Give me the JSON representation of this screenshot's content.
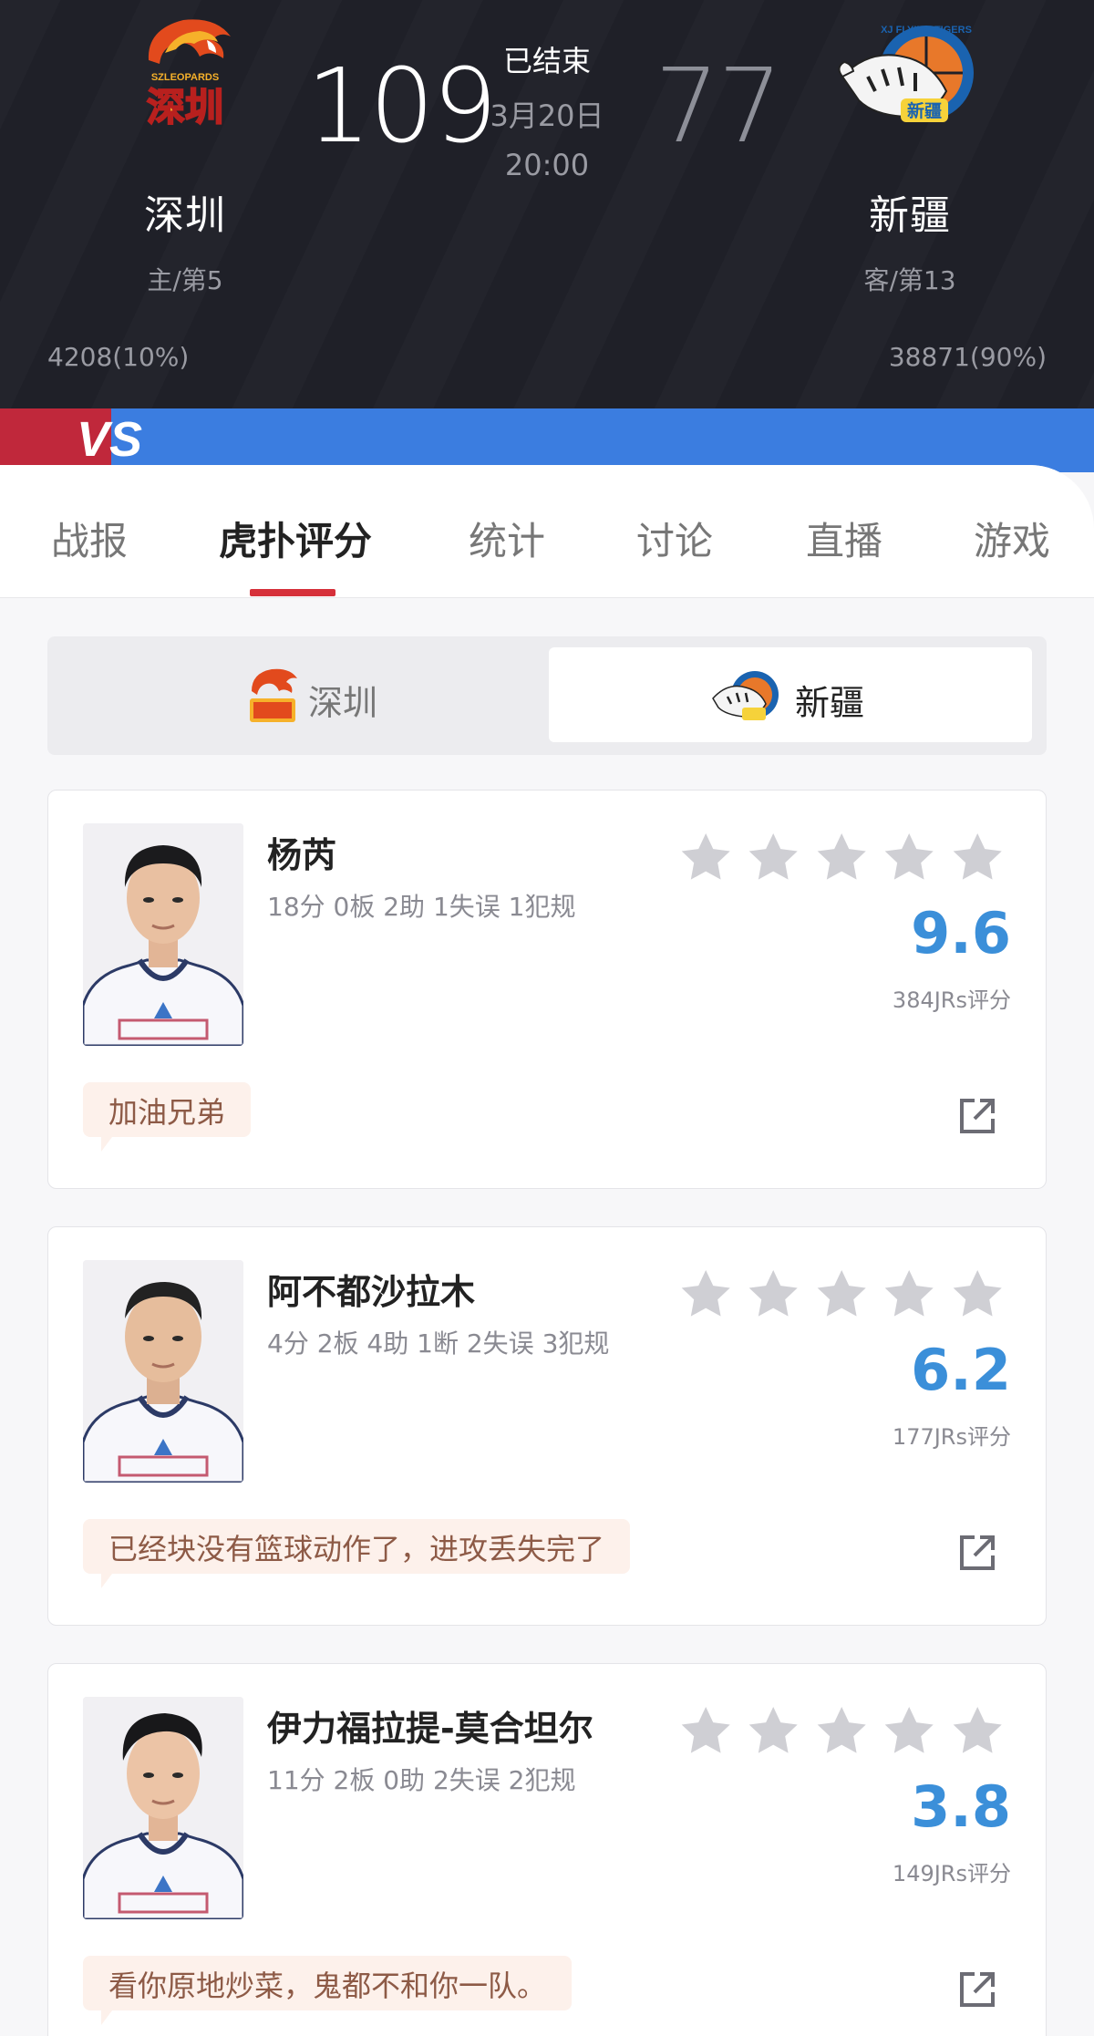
{
  "header": {
    "status": "已结束",
    "date": "3月20日",
    "time": "20:00",
    "home": {
      "name": "深圳",
      "rank": "主/第5",
      "score": "109",
      "support": "4208(10%)",
      "logo_text_top": "SZLEOPARDS",
      "logo_text_main": "深圳"
    },
    "away": {
      "name": "新疆",
      "rank": "客/第13",
      "score": "77",
      "support": "38871(90%)",
      "logo_text_ring": "XJ FLYING TIGERS",
      "logo_text_main": "新疆"
    },
    "vs_label": "VS",
    "support_fraction": {
      "home": 0.1,
      "away": 0.9
    }
  },
  "tabs": [
    {
      "label": "战报"
    },
    {
      "label": "虎扑评分"
    },
    {
      "label": "统计"
    },
    {
      "label": "讨论"
    },
    {
      "label": "直播"
    },
    {
      "label": "游戏"
    }
  ],
  "team_switch": {
    "home": "深圳",
    "away": "新疆",
    "selected": "away"
  },
  "players": [
    {
      "name": "杨芮",
      "stats": "18分 0板 2助 1失误 1犯规",
      "rating": "9.6",
      "count": "384JRs评分",
      "comment": "加油兄弟"
    },
    {
      "name": "阿不都沙拉木",
      "stats": "4分 2板 4助 1断 2失误 3犯规",
      "rating": "6.2",
      "count": "177JRs评分",
      "comment": "已经块没有篮球动作了，进攻丢失完了"
    },
    {
      "name": "伊力福拉提-莫合坦尔",
      "stats": "11分 2板 0助 2失误 2犯规",
      "rating": "3.8",
      "count": "149JRs评分",
      "comment": "看你原地炒菜，鬼都不和你一队。"
    }
  ],
  "colors": {
    "accent_red": "#d6303a",
    "rating_blue": "#3b8fd9",
    "star_gray": "#cfcfd4",
    "bar_red": "#c0283b",
    "bar_blue": "#3b7de0"
  },
  "icons": {
    "star": "star-icon",
    "share": "share-icon"
  }
}
